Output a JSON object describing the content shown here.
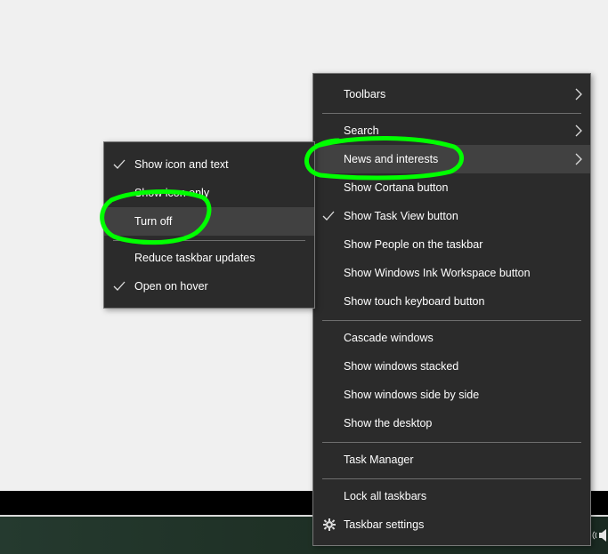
{
  "main_menu": {
    "items": [
      {
        "label": "Toolbars",
        "arrow": true
      },
      {
        "label": "Search",
        "arrow": true
      },
      {
        "label": "News and interests",
        "arrow": true,
        "highlighted": true
      },
      {
        "label": "Show Cortana button"
      },
      {
        "label": "Show Task View button",
        "checked": true
      },
      {
        "label": "Show People on the taskbar"
      },
      {
        "label": "Show Windows Ink Workspace button"
      },
      {
        "label": "Show touch keyboard button"
      },
      {
        "label": "Cascade windows"
      },
      {
        "label": "Show windows stacked"
      },
      {
        "label": "Show windows side by side"
      },
      {
        "label": "Show the desktop"
      },
      {
        "label": "Task Manager"
      },
      {
        "label": "Lock all taskbars"
      },
      {
        "label": "Taskbar settings",
        "icon": "gear-icon"
      }
    ]
  },
  "sub_menu": {
    "items": [
      {
        "label": "Show icon and text",
        "checked": true
      },
      {
        "label": "Show icon only"
      },
      {
        "label": "Turn off",
        "highlighted": true
      },
      {
        "label": "Reduce taskbar updates"
      },
      {
        "label": "Open on hover",
        "checked": true
      }
    ]
  },
  "annotation_color": "#00ff00",
  "colors": {
    "menu_bg": "#2b2b2b",
    "menu_highlight": "#414141",
    "menu_text": "#ffffff",
    "desktop_bg": "#f0f0f0"
  }
}
